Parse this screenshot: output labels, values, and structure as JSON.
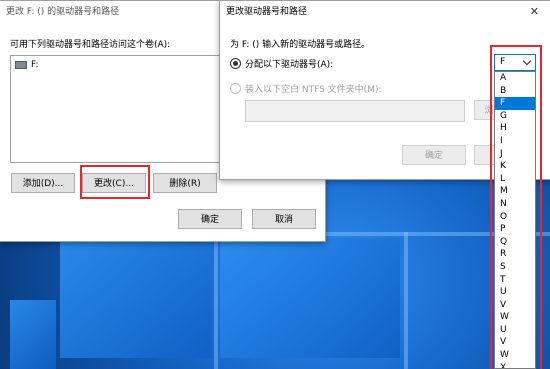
{
  "dialog_back": {
    "title": "更改 F: () 的驱动器号和路径",
    "list_label": "可用下列驱动器号和路径访问这个卷(A):",
    "list_items": [
      "F:"
    ],
    "add_label": "添加(D)...",
    "change_label": "更改(C)...",
    "remove_label": "删除(R)",
    "ok_label": "确定",
    "cancel_label": "取消"
  },
  "dialog_front": {
    "title": "更改驱动器号和路径",
    "close_glyph": "✕",
    "prompt": "为 F: () 输入新的驱动器号或路径。",
    "assign_label": "分配以下驱动器号(A):",
    "mount_label": "装入以下空白 NTFS 文件夹中(M):",
    "browse_label": "浏",
    "ok_label": "确定",
    "drive_select_value": "F",
    "drive_options": [
      "A",
      "B",
      "F",
      "G",
      "H",
      "I",
      "J",
      "K",
      "L",
      "M",
      "N",
      "O",
      "P",
      "Q",
      "R",
      "S",
      "T",
      "U",
      "V",
      "W",
      "U",
      "V",
      "W",
      "X"
    ],
    "selected_option": "F"
  },
  "colors": {
    "highlight": "#0078d7",
    "annotation_red": "#e8262b"
  }
}
